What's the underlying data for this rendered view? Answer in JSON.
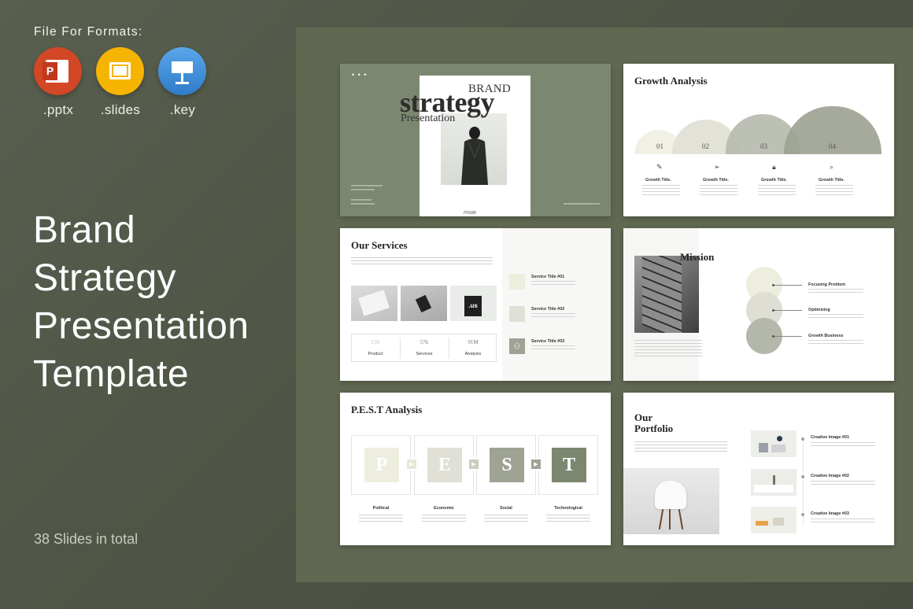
{
  "formats": {
    "title": "File For Formats:",
    "items": [
      {
        "label": ".pptx",
        "icon": "powerpoint-icon",
        "color": "#d04423"
      },
      {
        "label": ".slides",
        "icon": "google-slides-icon",
        "color": "#f4b400"
      },
      {
        "label": ".key",
        "icon": "keynote-icon",
        "color": "#3e8ed8"
      }
    ]
  },
  "headline": [
    "Brand",
    "Strategy",
    "Presentation",
    "Template"
  ],
  "total": "38 Slides in total",
  "slide1": {
    "brand": "BRAND",
    "strategy": "strategy",
    "presentation": "Presentation",
    "your": "/YOUR"
  },
  "slide2": {
    "title": "Growth Analysis",
    "nums": [
      "01",
      "02",
      "03",
      "04"
    ],
    "items": [
      {
        "label": "Growth Title."
      },
      {
        "label": "Growth Title."
      },
      {
        "label": "Growth Title."
      },
      {
        "label": "Growth Title."
      }
    ]
  },
  "slide3": {
    "title": "Our Services",
    "stats": [
      {
        "value": "53K",
        "label": "Product"
      },
      {
        "value": "57k",
        "label": "Services"
      },
      {
        "value": "91M",
        "label": "Analysis"
      }
    ],
    "services": [
      "Service Title #01",
      "Service Title #02",
      "Service Title #03"
    ],
    "bag_text": ".us"
  },
  "slide4": {
    "title": "Mission",
    "items": [
      "Focusing Problem",
      "Optimizing",
      "Growth Business"
    ]
  },
  "slide5": {
    "title": "P.E.S.T Analysis",
    "letters": [
      "P",
      "E",
      "S",
      "T"
    ],
    "labels": [
      "Political",
      "Economic",
      "Social",
      "Technological"
    ]
  },
  "slide6": {
    "title_line1": "Our",
    "title_line2": "Portfolio",
    "items": [
      "Creative Image #01",
      "Creative Image #02",
      "Creative Image #03"
    ]
  },
  "colors": {
    "background": "#4f5546",
    "panel": "#606852",
    "sage": "#7c8770",
    "sage_light": "#eeeedf",
    "sage_mid": "#b4b8aa"
  }
}
